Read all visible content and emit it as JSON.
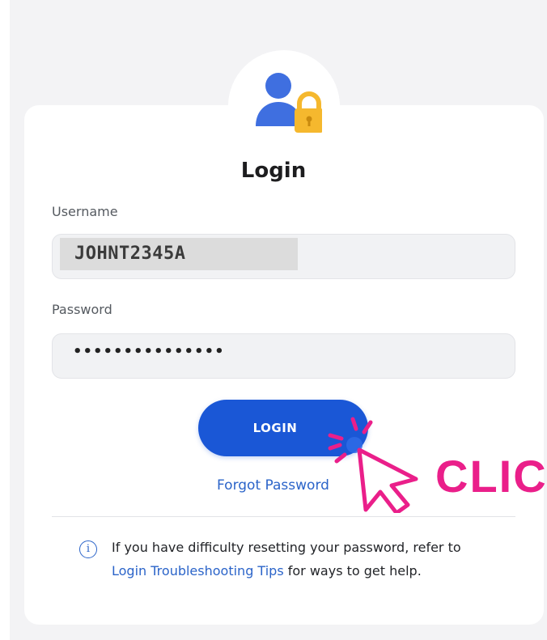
{
  "login": {
    "title": "Login",
    "username_label": "Username",
    "username_value": "JOHNT2345A",
    "password_label": "Password",
    "password_value": "•••••••••••••••",
    "button_label": "LOGIN",
    "forgot_link": "Forgot Password"
  },
  "info": {
    "text_before": "If you have difficulty resetting your password, refer to ",
    "link": "Login Troubleshooting Tips",
    "text_after": " for ways to get help."
  },
  "overlay": {
    "click_text": "CLIC"
  },
  "icons": {
    "avatar": "user-lock-icon",
    "info": "info-icon",
    "cursor": "cursor-click-icon"
  },
  "colors": {
    "accent": "#1a57d6",
    "link": "#2b64c9",
    "lock": "#f5b82e",
    "highlight": "#ea1f8a"
  }
}
